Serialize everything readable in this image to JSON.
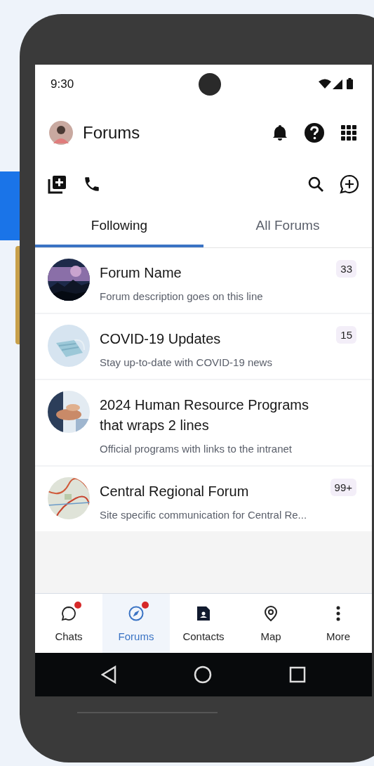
{
  "status_bar": {
    "time": "9:30"
  },
  "app_bar": {
    "title": "Forums"
  },
  "tabs": [
    {
      "label": "Following",
      "selected": true
    },
    {
      "label": "All Forums",
      "selected": false
    }
  ],
  "forums": [
    {
      "name": "Forum Name",
      "description": "Forum description goes on this line",
      "unread": "33"
    },
    {
      "name": "COVID-19 Updates",
      "description": "Stay up-to-date with COVID-19 news",
      "unread": "15"
    },
    {
      "name": "2024 Human Resource Programs that wraps 2 lines",
      "description": "Official programs with links to the intranet"
    },
    {
      "name": "Central Regional Forum",
      "description": "Site specific communication for Central Re...",
      "unread": "99+"
    }
  ],
  "bottom_nav": [
    {
      "label": "Chats",
      "selected": false,
      "notification": true
    },
    {
      "label": "Forums",
      "selected": true,
      "notification": true
    },
    {
      "label": "Contacts",
      "selected": false,
      "notification": false
    },
    {
      "label": "Map",
      "selected": false,
      "notification": false
    },
    {
      "label": "More",
      "selected": false,
      "notification": false
    }
  ]
}
